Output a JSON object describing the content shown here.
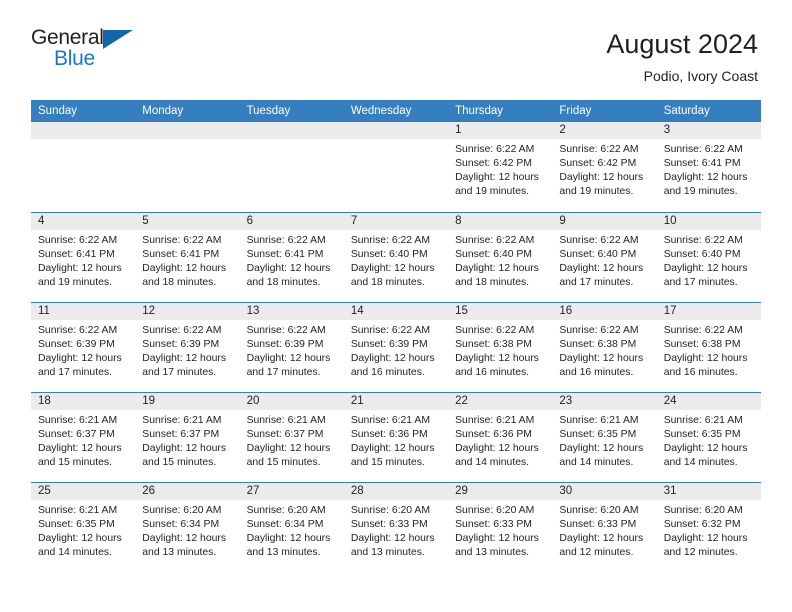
{
  "brand": {
    "name_dark": "General",
    "name_light": "Blue",
    "triangle_icon": "triangle-icon",
    "accent_color": "#1878c8",
    "triangle_color": "#1266ab"
  },
  "header": {
    "title": "August 2024",
    "subtitle": "Podio, Ivory Coast"
  },
  "calendar": {
    "header_bg": "#357ec0",
    "daynum_bg": "#ebebeb",
    "weekday_headers": [
      "Sunday",
      "Monday",
      "Tuesday",
      "Wednesday",
      "Thursday",
      "Friday",
      "Saturday"
    ],
    "weeks": [
      [
        {
          "day": "",
          "empty": true,
          "sunrise": "",
          "sunset": "",
          "daylight1": "",
          "daylight2": ""
        },
        {
          "day": "",
          "empty": true,
          "sunrise": "",
          "sunset": "",
          "daylight1": "",
          "daylight2": ""
        },
        {
          "day": "",
          "empty": true,
          "sunrise": "",
          "sunset": "",
          "daylight1": "",
          "daylight2": ""
        },
        {
          "day": "",
          "empty": true,
          "sunrise": "",
          "sunset": "",
          "daylight1": "",
          "daylight2": ""
        },
        {
          "day": "1",
          "empty": false,
          "sunrise": "Sunrise: 6:22 AM",
          "sunset": "Sunset: 6:42 PM",
          "daylight1": "Daylight: 12 hours",
          "daylight2": "and 19 minutes."
        },
        {
          "day": "2",
          "empty": false,
          "sunrise": "Sunrise: 6:22 AM",
          "sunset": "Sunset: 6:42 PM",
          "daylight1": "Daylight: 12 hours",
          "daylight2": "and 19 minutes."
        },
        {
          "day": "3",
          "empty": false,
          "sunrise": "Sunrise: 6:22 AM",
          "sunset": "Sunset: 6:41 PM",
          "daylight1": "Daylight: 12 hours",
          "daylight2": "and 19 minutes."
        }
      ],
      [
        {
          "day": "4",
          "empty": false,
          "sunrise": "Sunrise: 6:22 AM",
          "sunset": "Sunset: 6:41 PM",
          "daylight1": "Daylight: 12 hours",
          "daylight2": "and 19 minutes."
        },
        {
          "day": "5",
          "empty": false,
          "sunrise": "Sunrise: 6:22 AM",
          "sunset": "Sunset: 6:41 PM",
          "daylight1": "Daylight: 12 hours",
          "daylight2": "and 18 minutes."
        },
        {
          "day": "6",
          "empty": false,
          "sunrise": "Sunrise: 6:22 AM",
          "sunset": "Sunset: 6:41 PM",
          "daylight1": "Daylight: 12 hours",
          "daylight2": "and 18 minutes."
        },
        {
          "day": "7",
          "empty": false,
          "sunrise": "Sunrise: 6:22 AM",
          "sunset": "Sunset: 6:40 PM",
          "daylight1": "Daylight: 12 hours",
          "daylight2": "and 18 minutes."
        },
        {
          "day": "8",
          "empty": false,
          "sunrise": "Sunrise: 6:22 AM",
          "sunset": "Sunset: 6:40 PM",
          "daylight1": "Daylight: 12 hours",
          "daylight2": "and 18 minutes."
        },
        {
          "day": "9",
          "empty": false,
          "sunrise": "Sunrise: 6:22 AM",
          "sunset": "Sunset: 6:40 PM",
          "daylight1": "Daylight: 12 hours",
          "daylight2": "and 17 minutes."
        },
        {
          "day": "10",
          "empty": false,
          "sunrise": "Sunrise: 6:22 AM",
          "sunset": "Sunset: 6:40 PM",
          "daylight1": "Daylight: 12 hours",
          "daylight2": "and 17 minutes."
        }
      ],
      [
        {
          "day": "11",
          "empty": false,
          "sunrise": "Sunrise: 6:22 AM",
          "sunset": "Sunset: 6:39 PM",
          "daylight1": "Daylight: 12 hours",
          "daylight2": "and 17 minutes."
        },
        {
          "day": "12",
          "empty": false,
          "sunrise": "Sunrise: 6:22 AM",
          "sunset": "Sunset: 6:39 PM",
          "daylight1": "Daylight: 12 hours",
          "daylight2": "and 17 minutes."
        },
        {
          "day": "13",
          "empty": false,
          "sunrise": "Sunrise: 6:22 AM",
          "sunset": "Sunset: 6:39 PM",
          "daylight1": "Daylight: 12 hours",
          "daylight2": "and 17 minutes."
        },
        {
          "day": "14",
          "empty": false,
          "sunrise": "Sunrise: 6:22 AM",
          "sunset": "Sunset: 6:39 PM",
          "daylight1": "Daylight: 12 hours",
          "daylight2": "and 16 minutes."
        },
        {
          "day": "15",
          "empty": false,
          "sunrise": "Sunrise: 6:22 AM",
          "sunset": "Sunset: 6:38 PM",
          "daylight1": "Daylight: 12 hours",
          "daylight2": "and 16 minutes."
        },
        {
          "day": "16",
          "empty": false,
          "sunrise": "Sunrise: 6:22 AM",
          "sunset": "Sunset: 6:38 PM",
          "daylight1": "Daylight: 12 hours",
          "daylight2": "and 16 minutes."
        },
        {
          "day": "17",
          "empty": false,
          "sunrise": "Sunrise: 6:22 AM",
          "sunset": "Sunset: 6:38 PM",
          "daylight1": "Daylight: 12 hours",
          "daylight2": "and 16 minutes."
        }
      ],
      [
        {
          "day": "18",
          "empty": false,
          "sunrise": "Sunrise: 6:21 AM",
          "sunset": "Sunset: 6:37 PM",
          "daylight1": "Daylight: 12 hours",
          "daylight2": "and 15 minutes."
        },
        {
          "day": "19",
          "empty": false,
          "sunrise": "Sunrise: 6:21 AM",
          "sunset": "Sunset: 6:37 PM",
          "daylight1": "Daylight: 12 hours",
          "daylight2": "and 15 minutes."
        },
        {
          "day": "20",
          "empty": false,
          "sunrise": "Sunrise: 6:21 AM",
          "sunset": "Sunset: 6:37 PM",
          "daylight1": "Daylight: 12 hours",
          "daylight2": "and 15 minutes."
        },
        {
          "day": "21",
          "empty": false,
          "sunrise": "Sunrise: 6:21 AM",
          "sunset": "Sunset: 6:36 PM",
          "daylight1": "Daylight: 12 hours",
          "daylight2": "and 15 minutes."
        },
        {
          "day": "22",
          "empty": false,
          "sunrise": "Sunrise: 6:21 AM",
          "sunset": "Sunset: 6:36 PM",
          "daylight1": "Daylight: 12 hours",
          "daylight2": "and 14 minutes."
        },
        {
          "day": "23",
          "empty": false,
          "sunrise": "Sunrise: 6:21 AM",
          "sunset": "Sunset: 6:35 PM",
          "daylight1": "Daylight: 12 hours",
          "daylight2": "and 14 minutes."
        },
        {
          "day": "24",
          "empty": false,
          "sunrise": "Sunrise: 6:21 AM",
          "sunset": "Sunset: 6:35 PM",
          "daylight1": "Daylight: 12 hours",
          "daylight2": "and 14 minutes."
        }
      ],
      [
        {
          "day": "25",
          "empty": false,
          "sunrise": "Sunrise: 6:21 AM",
          "sunset": "Sunset: 6:35 PM",
          "daylight1": "Daylight: 12 hours",
          "daylight2": "and 14 minutes."
        },
        {
          "day": "26",
          "empty": false,
          "sunrise": "Sunrise: 6:20 AM",
          "sunset": "Sunset: 6:34 PM",
          "daylight1": "Daylight: 12 hours",
          "daylight2": "and 13 minutes."
        },
        {
          "day": "27",
          "empty": false,
          "sunrise": "Sunrise: 6:20 AM",
          "sunset": "Sunset: 6:34 PM",
          "daylight1": "Daylight: 12 hours",
          "daylight2": "and 13 minutes."
        },
        {
          "day": "28",
          "empty": false,
          "sunrise": "Sunrise: 6:20 AM",
          "sunset": "Sunset: 6:33 PM",
          "daylight1": "Daylight: 12 hours",
          "daylight2": "and 13 minutes."
        },
        {
          "day": "29",
          "empty": false,
          "sunrise": "Sunrise: 6:20 AM",
          "sunset": "Sunset: 6:33 PM",
          "daylight1": "Daylight: 12 hours",
          "daylight2": "and 13 minutes."
        },
        {
          "day": "30",
          "empty": false,
          "sunrise": "Sunrise: 6:20 AM",
          "sunset": "Sunset: 6:33 PM",
          "daylight1": "Daylight: 12 hours",
          "daylight2": "and 12 minutes."
        },
        {
          "day": "31",
          "empty": false,
          "sunrise": "Sunrise: 6:20 AM",
          "sunset": "Sunset: 6:32 PM",
          "daylight1": "Daylight: 12 hours",
          "daylight2": "and 12 minutes."
        }
      ]
    ]
  }
}
